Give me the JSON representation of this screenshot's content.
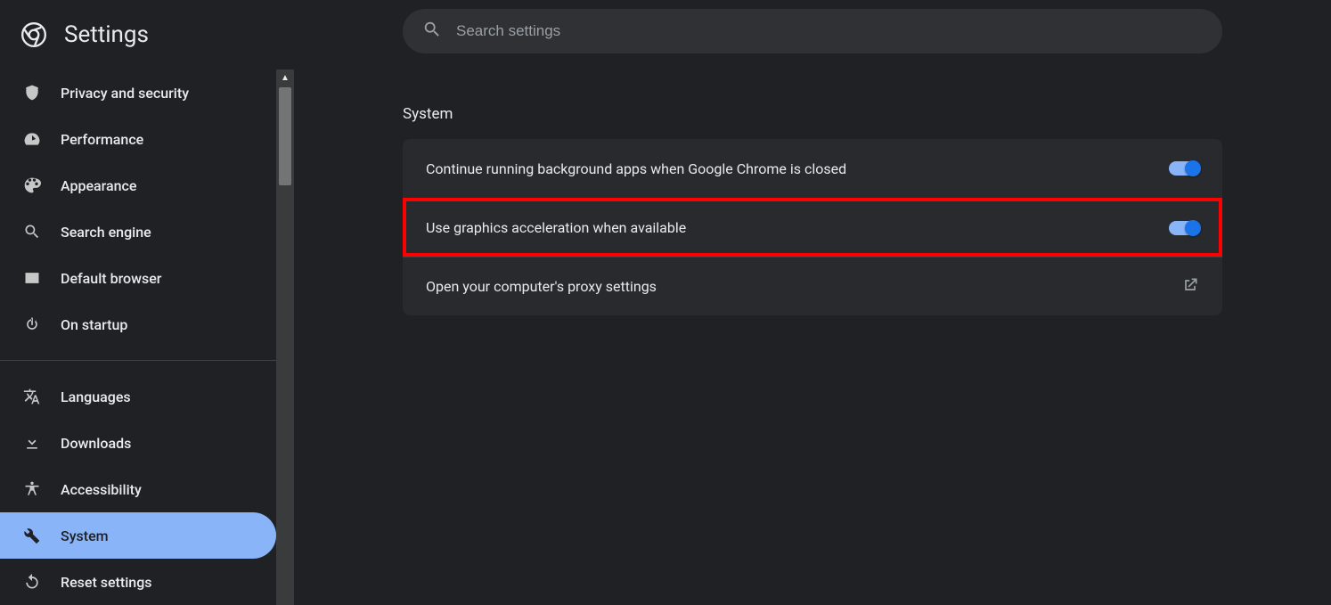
{
  "header": {
    "title": "Settings"
  },
  "search": {
    "placeholder": "Search settings"
  },
  "sidebar": {
    "items": [
      {
        "label": "Privacy and security"
      },
      {
        "label": "Performance"
      },
      {
        "label": "Appearance"
      },
      {
        "label": "Search engine"
      },
      {
        "label": "Default browser"
      },
      {
        "label": "On startup"
      },
      {
        "label": "Languages"
      },
      {
        "label": "Downloads"
      },
      {
        "label": "Accessibility"
      },
      {
        "label": "System"
      },
      {
        "label": "Reset settings"
      }
    ]
  },
  "main": {
    "section_title": "System",
    "rows": [
      {
        "label": "Continue running background apps when Google Chrome is closed"
      },
      {
        "label": "Use graphics acceleration when available"
      },
      {
        "label": "Open your computer's proxy settings"
      }
    ]
  }
}
